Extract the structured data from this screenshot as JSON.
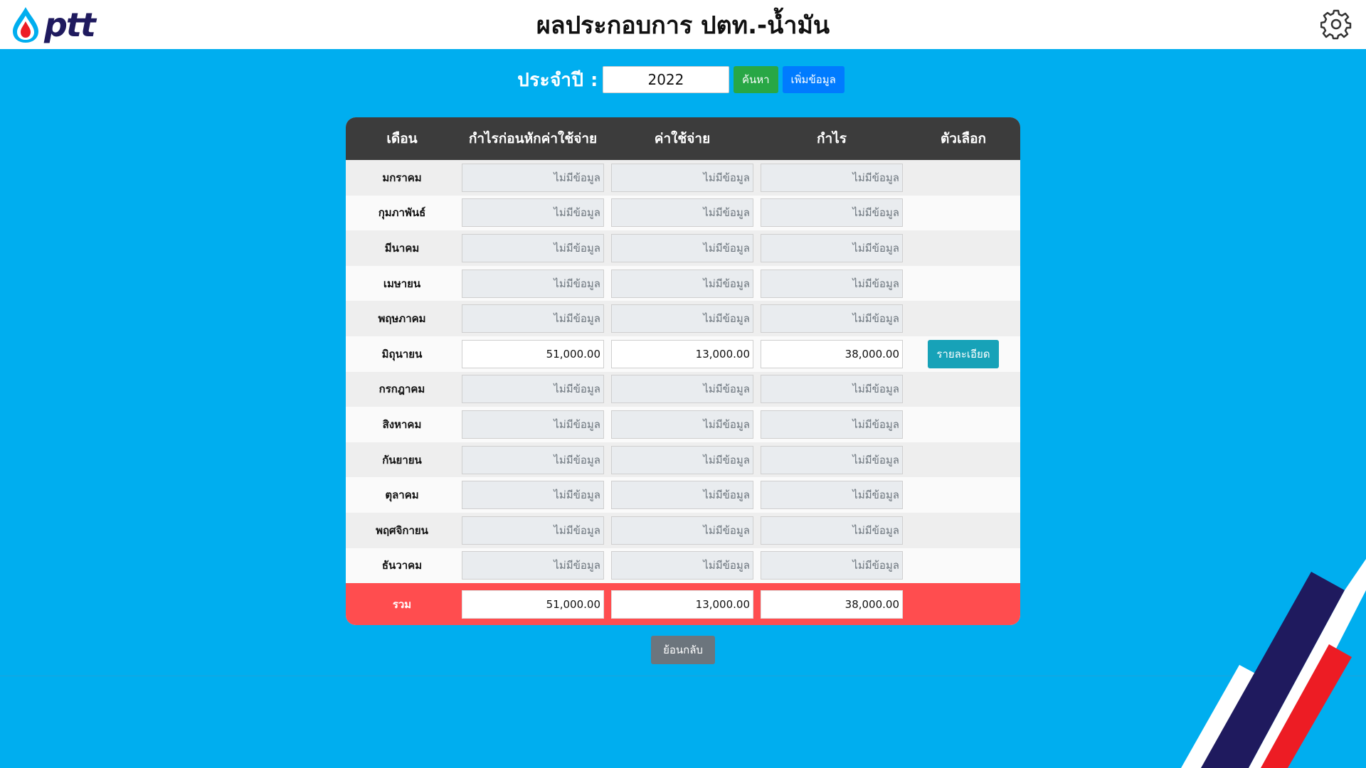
{
  "header": {
    "logo_text": "ptt",
    "title": "ผลประกอบการ ปตท.-น้ำมัน"
  },
  "filter": {
    "year_label": "ประจำปี :",
    "year_value": "2022",
    "search_label": "ค้นหา",
    "add_label": "เพิ่มข้อมูล"
  },
  "table": {
    "headers": [
      "เดือน",
      "กำไรก่อนหักค่าใช้จ่าย",
      "ค่าใช้จ่าย",
      "กำไร",
      "ตัวเลือก"
    ],
    "rows": [
      {
        "month": "มกราคม",
        "gross": "ไม่มีข้อมูล",
        "expense": "ไม่มีข้อมูล",
        "profit": "ไม่มีข้อมูล",
        "has_data": false
      },
      {
        "month": "กุมภาพันธ์",
        "gross": "ไม่มีข้อมูล",
        "expense": "ไม่มีข้อมูล",
        "profit": "ไม่มีข้อมูล",
        "has_data": false
      },
      {
        "month": "มีนาคม",
        "gross": "ไม่มีข้อมูล",
        "expense": "ไม่มีข้อมูล",
        "profit": "ไม่มีข้อมูล",
        "has_data": false
      },
      {
        "month": "เมษายน",
        "gross": "ไม่มีข้อมูล",
        "expense": "ไม่มีข้อมูล",
        "profit": "ไม่มีข้อมูล",
        "has_data": false
      },
      {
        "month": "พฤษภาคม",
        "gross": "ไม่มีข้อมูล",
        "expense": "ไม่มีข้อมูล",
        "profit": "ไม่มีข้อมูล",
        "has_data": false
      },
      {
        "month": "มิถุนายน",
        "gross": "51,000.00",
        "expense": "13,000.00",
        "profit": "38,000.00",
        "has_data": true,
        "action": "รายละเอียด"
      },
      {
        "month": "กรกฎาคม",
        "gross": "ไม่มีข้อมูล",
        "expense": "ไม่มีข้อมูล",
        "profit": "ไม่มีข้อมูล",
        "has_data": false
      },
      {
        "month": "สิงหาคม",
        "gross": "ไม่มีข้อมูล",
        "expense": "ไม่มีข้อมูล",
        "profit": "ไม่มีข้อมูล",
        "has_data": false
      },
      {
        "month": "กันยายน",
        "gross": "ไม่มีข้อมูล",
        "expense": "ไม่มีข้อมูล",
        "profit": "ไม่มีข้อมูล",
        "has_data": false
      },
      {
        "month": "ตุลาคม",
        "gross": "ไม่มีข้อมูล",
        "expense": "ไม่มีข้อมูล",
        "profit": "ไม่มีข้อมูล",
        "has_data": false
      },
      {
        "month": "พฤศจิกายน",
        "gross": "ไม่มีข้อมูล",
        "expense": "ไม่มีข้อมูล",
        "profit": "ไม่มีข้อมูล",
        "has_data": false
      },
      {
        "month": "ธันวาคม",
        "gross": "ไม่มีข้อมูล",
        "expense": "ไม่มีข้อมูล",
        "profit": "ไม่มีข้อมูล",
        "has_data": false
      }
    ],
    "total": {
      "label": "รวม",
      "gross": "51,000.00",
      "expense": "13,000.00",
      "profit": "38,000.00"
    }
  },
  "back_label": "ย้อนกลับ",
  "icons": {
    "logo": "ptt-drop-logo",
    "settings": "gear-icon"
  },
  "colors": {
    "background": "#00aeef",
    "header_row": "#3c3c3c",
    "total_row": "#ff4d4f",
    "search_button": "#28a745",
    "add_button": "#007bff",
    "detail_button": "#17a2b8",
    "back_button": "#6c757d",
    "stripe_navy": "#1f1a5e",
    "stripe_red": "#ed1c24"
  }
}
